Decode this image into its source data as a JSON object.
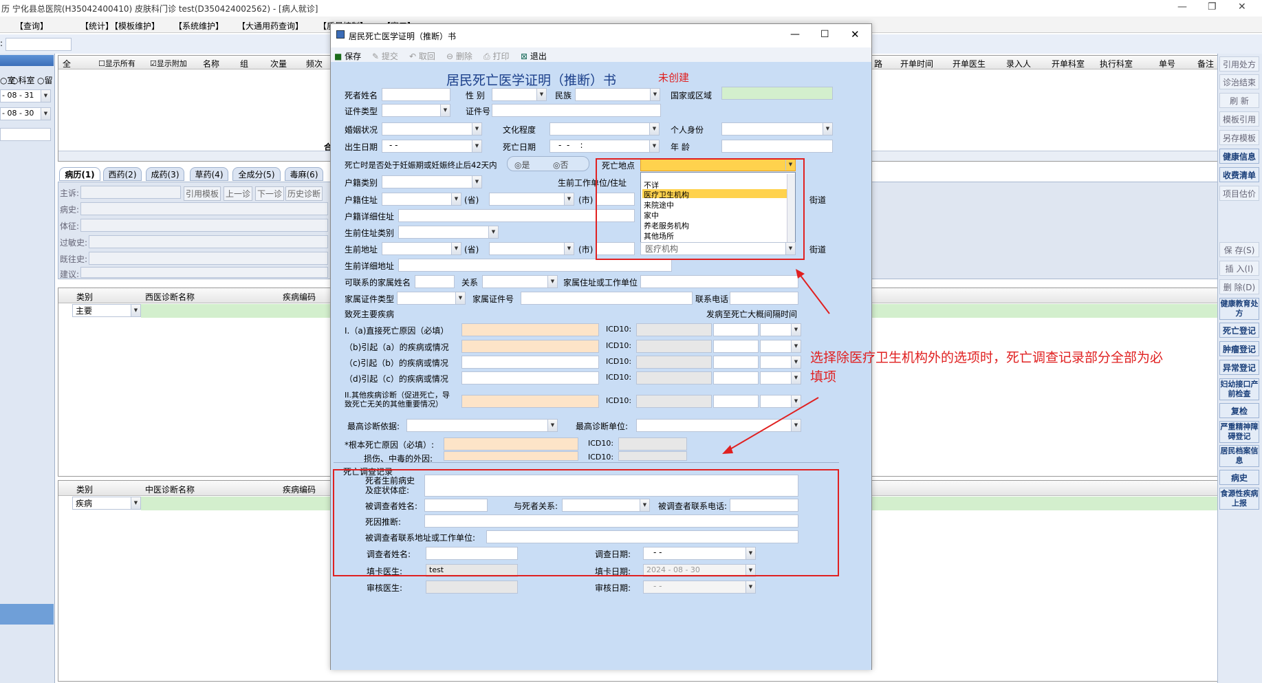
{
  "window": {
    "title": "历  宁化县总医院(H35042400410)  皮肤科门诊  test(D350424002562) - [病人就诊]",
    "min": "—",
    "max": "❐",
    "close": "✕"
  },
  "menu": [
    "【查询】",
    "【统计】",
    "【模板维护】",
    "【系统维护】",
    "【大通用药查询】",
    "【质量控制】",
    "【窗口】"
  ],
  "left": {
    "radio1": "室",
    "radio2": "科室",
    "radio3": "留",
    "date1": "- 08 - 31",
    "date2": "- 08 - 30",
    "label": ":"
  },
  "grid": {
    "headers": [
      "全",
      "显示所有",
      "显示附加",
      "名称",
      "组",
      "次量",
      "频次",
      "合"
    ],
    "right_headers": [
      "路",
      "开单时间",
      "开单医生",
      "录入人",
      "开单科室",
      "执行科室",
      "单号",
      "备注"
    ]
  },
  "tabs": [
    "病历(1)",
    "西药(2)",
    "成药(3)",
    "草药(4)",
    "全成分(5)",
    "毒麻(6)"
  ],
  "record": {
    "fields": [
      "主诉:",
      "病史:",
      "体征:",
      "过敏史:",
      "既往史:",
      "建议:"
    ],
    "buttons": [
      "引用模板",
      "上一诊",
      "下一诊",
      "历史诊断"
    ]
  },
  "diag_west": {
    "headers": [
      "类别",
      "西医诊断名称",
      "疾病编码"
    ],
    "value": "主要"
  },
  "diag_tcm": {
    "headers": [
      "类别",
      "中医诊断名称",
      "疾病编码"
    ],
    "value": "疾病"
  },
  "right_buttons": [
    "引用处方",
    "诊治结束",
    "刷 新",
    "模板引用",
    "另存模板",
    "健康信息",
    "收费清单",
    "项目估价",
    "保 存(S)",
    "插 入(I)",
    "删 除(D)",
    "健康教育处方",
    "死亡登记",
    "肿瘤登记",
    "异常登记",
    "妇幼接口产前检查",
    "复检",
    "严重精神障碍登记",
    "居民档案信息",
    "病史",
    "食源性疾病上报"
  ],
  "dialog": {
    "title": "居民死亡医学证明（推断）书",
    "toolbar": [
      "保存",
      "提交",
      "取回",
      "删除",
      "打印",
      "退出"
    ],
    "heading": "居民死亡医学证明（推断）书",
    "status": "未创建",
    "labels": {
      "name": "死者姓名",
      "sex": "性 别",
      "ethnic": "民族",
      "country": "国家或区域",
      "idtype": "证件类型",
      "idno": "证件号",
      "marital": "婚姻状况",
      "edu": "文化程度",
      "identity": "个人身份",
      "birth": "出生日期",
      "death_date": "死亡日期",
      "age": "年 龄",
      "pregnant": "死亡时是否处于妊娠期或妊娠终止后42天内",
      "yes": "是",
      "no": "否",
      "death_place": "死亡地点",
      "hukou_type": "户籍类别",
      "work_addr": "生前工作单位/住址",
      "hukou_addr": "户籍住址",
      "prov": "(省)",
      "city": "(市)",
      "street": "街道",
      "hukou_detail": "户籍详细住址",
      "live_type": "生前住址类别",
      "live_addr": "生前地址",
      "live_detail": "生前详细地址",
      "family_name": "可联系的家属姓名",
      "relation": "关系",
      "family_addr": "家属住址或工作单位",
      "family_idtype": "家属证件类型",
      "family_idno": "家属证件号",
      "phone": "联系电话",
      "cause_title": "致死主要疾病",
      "interval": "发病至死亡大概间隔时间",
      "cause_a": "I.（a)直接死亡原因（必填）",
      "cause_b": "（b)引起（a）的疾病或情况",
      "cause_c": "（c)引起（b）的疾病或情况",
      "cause_d": "（d)引起（c）的疾病或情况",
      "cause_other": "II.其他疾病诊断（促进死亡，导致死亡无关的其他重要情况）",
      "icd": "ICD10:",
      "diag_basis": "最高诊断依据:",
      "diag_unit": "最高诊断单位:",
      "root_cause": "*根本死亡原因（必填）:",
      "injury": "损伤、中毒的外因:",
      "survey_title": "死亡调查记录",
      "history": "死者生前病史及症状体症:",
      "surveyee": "被调查者姓名:",
      "surveyee_rel": "与死者关系:",
      "surveyee_phone": "被调查者联系电话:",
      "infer": "死因推断:",
      "surveyee_addr": "被调查者联系地址或工作单位:",
      "surveyor": "调查者姓名:",
      "survey_date": "调查日期:",
      "card_doc": "填卡医生:",
      "card_date": "填卡日期:",
      "audit_doc": "审核医生:",
      "audit_date": "审核日期:"
    },
    "values": {
      "birth": "-  -",
      "death_date": "-  -    :",
      "survey_date": "-  -",
      "card_doc": "test",
      "card_date": "2024 - 08 - 30",
      "audit_date": "-  -",
      "live_partial": "医疗机构"
    },
    "dropdown": {
      "options": [
        "不详",
        "医疗卫生机构",
        "来院途中",
        "家中",
        "养老服务机构",
        "其他场所"
      ],
      "selected": "医疗卫生机构"
    }
  },
  "annotation": {
    "text": "选择除医疗卫生机构外的选项时，死亡调查记录部分全部为必填项"
  }
}
